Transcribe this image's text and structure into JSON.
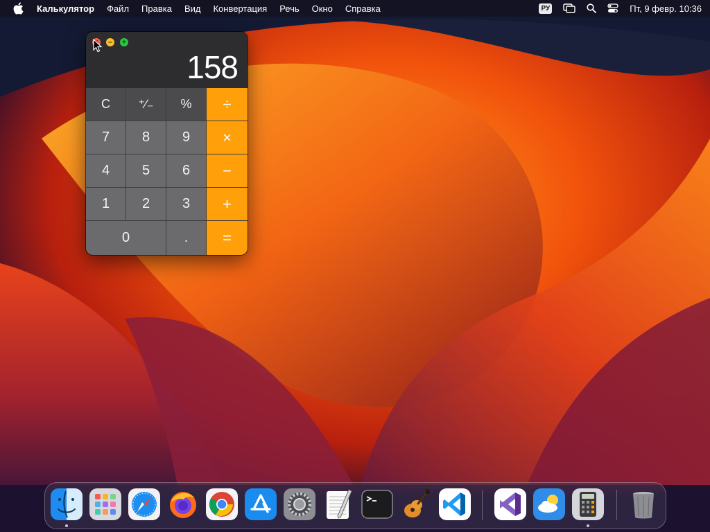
{
  "menubar": {
    "app_name": "Калькулятор",
    "menus": [
      "Файл",
      "Правка",
      "Вид",
      "Конвертация",
      "Речь",
      "Окно",
      "Справка"
    ],
    "input_source": "РУ",
    "clock": "Пт, 9 февр.  10:36",
    "icons": [
      "apple-icon",
      "screen-mirroring-icon",
      "search-icon",
      "control-center-icon"
    ]
  },
  "calculator": {
    "display": "158",
    "keys": {
      "clear": "C",
      "sign": "⁺∕₋",
      "percent": "%",
      "divide": "÷",
      "seven": "7",
      "eight": "8",
      "nine": "9",
      "multiply": "×",
      "four": "4",
      "five": "5",
      "six": "6",
      "minus": "−",
      "one": "1",
      "two": "2",
      "three": "3",
      "plus": "+",
      "zero": "0",
      "decimal": ".",
      "equals": "="
    },
    "colors": {
      "operator": "#ff9f0a",
      "number": "#6b6a6c",
      "function": "#4b4a4c"
    }
  },
  "dock": {
    "items": [
      {
        "name": "Finder",
        "icon": "finder-icon",
        "running": true
      },
      {
        "name": "Launchpad",
        "icon": "launchpad-icon",
        "running": false
      },
      {
        "name": "Safari",
        "icon": "safari-icon",
        "running": false
      },
      {
        "name": "Firefox",
        "icon": "firefox-icon",
        "running": false
      },
      {
        "name": "Chrome",
        "icon": "chrome-icon",
        "running": false
      },
      {
        "name": "App Store",
        "icon": "app-store-icon",
        "running": false
      },
      {
        "name": "System Preferences",
        "icon": "system-preferences-icon",
        "running": false
      },
      {
        "name": "TextEdit",
        "icon": "textedit-icon",
        "running": false
      },
      {
        "name": "Terminal",
        "icon": "terminal-icon",
        "running": false
      },
      {
        "name": "GarageBand",
        "icon": "garageband-icon",
        "running": false
      },
      {
        "name": "Visual Studio Code",
        "icon": "vscode-icon",
        "running": false
      },
      {
        "name": "Visual Studio",
        "icon": "visual-studio-icon",
        "running": false
      },
      {
        "name": "Weather",
        "icon": "weather-icon",
        "running": false
      },
      {
        "name": "Calculator",
        "icon": "calculator-icon",
        "running": true
      },
      {
        "name": "Trash",
        "icon": "trash-icon",
        "running": false
      }
    ]
  }
}
